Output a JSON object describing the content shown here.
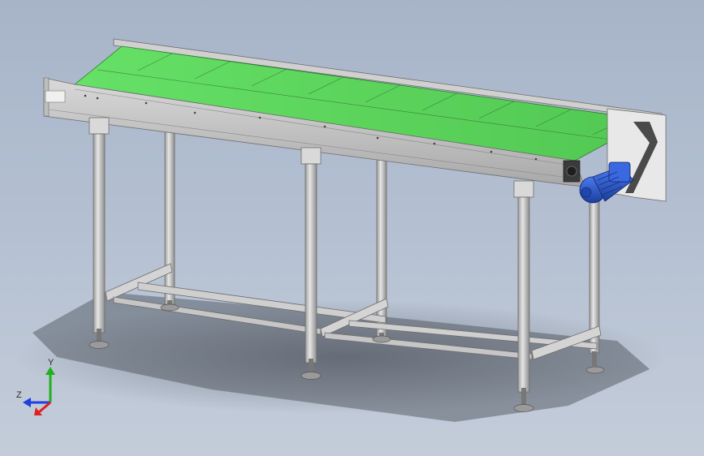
{
  "colors": {
    "background_top": "#a7b4c8",
    "background_bottom": "#c3ccd9",
    "belt_green": "#5cd65c",
    "frame_metal": "#c8c8c8",
    "motor_blue": "#2a55c8",
    "axis_x": "#e02020",
    "axis_y": "#20b020",
    "axis_z": "#2040e0"
  },
  "triad": {
    "y_label": "Y",
    "z_label": "Z"
  },
  "icons": [
    "coordinate-triad-icon"
  ]
}
